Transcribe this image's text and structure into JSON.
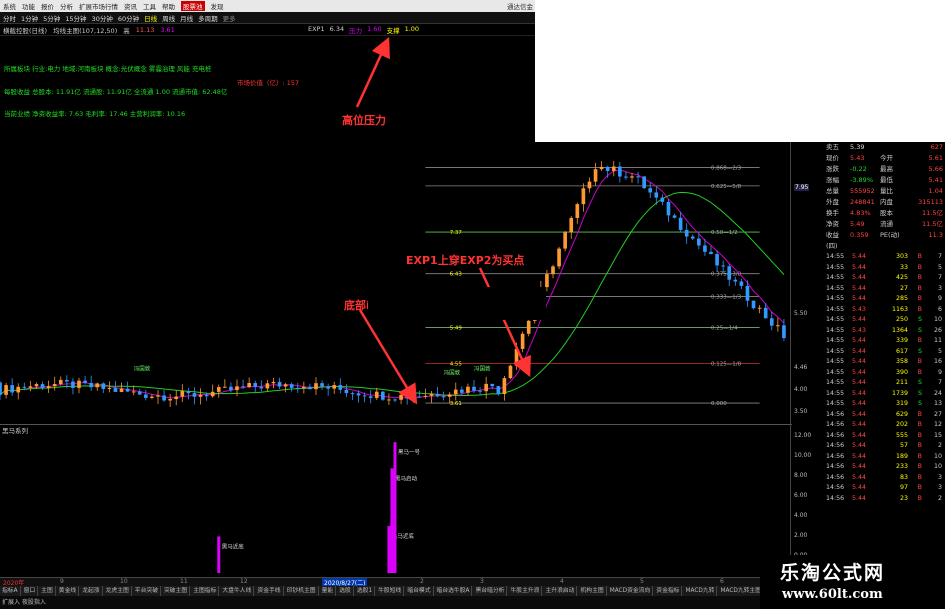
{
  "menu": {
    "items": [
      "系统",
      "功能",
      "报价",
      "分析",
      "扩展市场行情",
      "资讯",
      "工具",
      "帮助"
    ],
    "highlight_items": [
      "股票池",
      "发现"
    ],
    "app_name": "通达信金"
  },
  "toolbar": {
    "periods": [
      "分时",
      "1分钟",
      "5分钟",
      "15分钟",
      "30分钟",
      "60分钟",
      "日线",
      "周线",
      "月线",
      "多周期",
      "更多"
    ],
    "selected": "日线"
  },
  "info": {
    "main_label": "横截控股(日线)",
    "formula": "均线主图(107,12,50)",
    "high_label": "高",
    "high_value": "11.13",
    "mag_value": "3.61",
    "exp1_label": "EXP1",
    "exp1_value": "6.34",
    "pressure_label": "压力",
    "pressure_value": "1.60",
    "support_label": "支撑",
    "support_value": "1.00"
  },
  "text_lines": {
    "line1": "所属板块 行业:电力 地域:河南板块 概念:光伏概念 雾霾治理 风能 充电桩",
    "line2_a": "每股收益 总股本: 11.91亿 流通股: 11.91亿 全流通 1.00 流通市值: 62.48亿",
    "line3": "当前业绩 净资收益率: 7.63 毛利率: 17.46 主营利润率: 10.16",
    "red_note": "市场价值（亿）: 157"
  },
  "annotations": {
    "high_pressure": "高位压力",
    "buy_point": "EXP1上穿EXP2为买点",
    "bottom": "底部ⅰ"
  },
  "chart_data": {
    "type": "candlestick",
    "x_range": [
      0,
      130
    ],
    "y_range": [
      3.4,
      10.5
    ],
    "right_axis_ticks": [
      "7.95",
      "5.50",
      "4.46",
      "4.00",
      "3.50"
    ],
    "levels": [
      {
        "label": "0.868—2/3",
        "value": 9.83
      },
      {
        "label": "0.625—5/8",
        "value": 9.35
      },
      {
        "label": "0.50—1/2",
        "value": 8.14
      },
      {
        "label": "0.375—3/8",
        "value": 7.05
      },
      {
        "label": "0.333—1/3",
        "value": 6.45
      },
      {
        "label": "0.25—1/4",
        "value": 5.64
      },
      {
        "label": "0.125—1/8",
        "value": 4.7
      },
      {
        "label": "0.000",
        "value": 3.66
      }
    ],
    "level_prices": [
      {
        "label": "7.37",
        "value": 8.14
      },
      {
        "label": "6.43",
        "value": 7.05
      },
      {
        "label": "6.12",
        "value": 6.45
      },
      {
        "label": "5.49",
        "value": 5.64
      },
      {
        "label": "4.55",
        "value": 4.7
      },
      {
        "label": "3.61",
        "value": 3.66
      }
    ],
    "candle_labels": [
      "冯国敦",
      "冯国敦",
      "冯国敦"
    ],
    "sub_axis_ticks": [
      "12.00",
      "10.00",
      "8.00",
      "6.00",
      "4.00",
      "2.00",
      "0.00"
    ],
    "sub_bars": [
      {
        "x": 36,
        "value": 3.5,
        "label": "黑马近底"
      },
      {
        "x": 64,
        "value": 4.5,
        "label": "黑马近底"
      },
      {
        "x": 64.5,
        "value": 10.0,
        "label": "黑马启动"
      },
      {
        "x": 65,
        "value": 12.5,
        "label": "黑马一号"
      }
    ]
  },
  "sub_panel": {
    "title": "黑马系列"
  },
  "orderbook": [
    {
      "k": "卖五",
      "v1": "5.39",
      "k2": "",
      "v2": "627"
    },
    {
      "k": "现价",
      "v1": "5.43",
      "k2": "今开",
      "v2": "5.61"
    },
    {
      "k": "涨跌",
      "v1": "-0.22",
      "k2": "最高",
      "v2": "5.66"
    },
    {
      "k": "涨幅",
      "v1": "-3.89%",
      "k2": "最低",
      "v2": "5.41"
    },
    {
      "k": "总量",
      "v1": "555952",
      "k2": "量比",
      "v2": "1.04"
    },
    {
      "k": "外盘",
      "v1": "248841",
      "k2": "内盘",
      "v2": "315113"
    },
    {
      "k": "换手",
      "v1": "4.83%",
      "k2": "股本",
      "v2": "11.5亿"
    },
    {
      "k": "净资",
      "v1": "5.49",
      "k2": "流通",
      "v2": "11.5亿"
    },
    {
      "k": "收益(四)",
      "v1": "0.359",
      "k2": "PE(动)",
      "v2": "11.3"
    }
  ],
  "ticks": [
    {
      "t": "14:55",
      "p": "5.44",
      "v": "303",
      "s": "B",
      "n": "7"
    },
    {
      "t": "14:55",
      "p": "5.44",
      "v": "33",
      "s": "B",
      "n": "5"
    },
    {
      "t": "14:55",
      "p": "5.44",
      "v": "425",
      "s": "B",
      "n": "7"
    },
    {
      "t": "14:55",
      "p": "5.44",
      "v": "27",
      "s": "B",
      "n": "3"
    },
    {
      "t": "14:55",
      "p": "5.44",
      "v": "285",
      "s": "B",
      "n": "9"
    },
    {
      "t": "14:55",
      "p": "5.43",
      "v": "1163",
      "s": "B",
      "n": "6"
    },
    {
      "t": "14:55",
      "p": "5.44",
      "v": "250",
      "s": "S",
      "n": "10"
    },
    {
      "t": "14:55",
      "p": "5.43",
      "v": "1364",
      "s": "S",
      "n": "26"
    },
    {
      "t": "14:55",
      "p": "5.44",
      "v": "339",
      "s": "B",
      "n": "11"
    },
    {
      "t": "14:55",
      "p": "5.44",
      "v": "617",
      "s": "S",
      "n": "5"
    },
    {
      "t": "14:55",
      "p": "5.44",
      "v": "358",
      "s": "B",
      "n": "16"
    },
    {
      "t": "14:55",
      "p": "5.44",
      "v": "390",
      "s": "B",
      "n": "9"
    },
    {
      "t": "14:55",
      "p": "5.44",
      "v": "211",
      "s": "S",
      "n": "7"
    },
    {
      "t": "14:55",
      "p": "5.44",
      "v": "1739",
      "s": "S",
      "n": "24"
    },
    {
      "t": "14:55",
      "p": "5.44",
      "v": "319",
      "s": "S",
      "n": "13"
    },
    {
      "t": "14:56",
      "p": "5.44",
      "v": "629",
      "s": "B",
      "n": "27"
    },
    {
      "t": "14:56",
      "p": "5.44",
      "v": "202",
      "s": "B",
      "n": "12"
    },
    {
      "t": "14:56",
      "p": "5.44",
      "v": "555",
      "s": "B",
      "n": "15"
    },
    {
      "t": "14:56",
      "p": "5.44",
      "v": "57",
      "s": "B",
      "n": "2"
    },
    {
      "t": "14:56",
      "p": "5.44",
      "v": "189",
      "s": "B",
      "n": "10"
    },
    {
      "t": "14:56",
      "p": "5.44",
      "v": "233",
      "s": "B",
      "n": "10"
    },
    {
      "t": "14:56",
      "p": "5.44",
      "v": "83",
      "s": "B",
      "n": "3"
    },
    {
      "t": "14:56",
      "p": "5.44",
      "v": "97",
      "s": "B",
      "n": "3"
    },
    {
      "t": "14:56",
      "p": "5.44",
      "v": "23",
      "s": "B",
      "n": "2"
    }
  ],
  "datebar": {
    "start": "2020年",
    "current": "2020/8/27(二)",
    "marks": [
      "9",
      "10",
      "11",
      "12",
      "2",
      "3",
      "4",
      "5",
      "6"
    ]
  },
  "tabs": [
    "指标A",
    "窗口",
    "主图",
    "黄金线",
    "龙起涨",
    "龙虎主图",
    "平台突破",
    "突破主图",
    "主图指标",
    "大盘牛人线",
    "资金手线",
    "印钞机主图",
    "量能",
    "选股",
    "选股1",
    "牛股短线",
    "暗台模式",
    "暗台选牛股A",
    "黑台暗分析",
    "牛股主升浪",
    "主升浪启动",
    "机构主图",
    "MACD资金流向",
    "资金指标",
    "MACD九转",
    "MACD九转主图",
    "牛股主升浪",
    "牛股1",
    "牛股2"
  ],
  "statusbar": {
    "text": "扩展入 夜股指入"
  },
  "watermark": {
    "line1": "乐淘公式网",
    "line2": "www.60lt.com"
  }
}
